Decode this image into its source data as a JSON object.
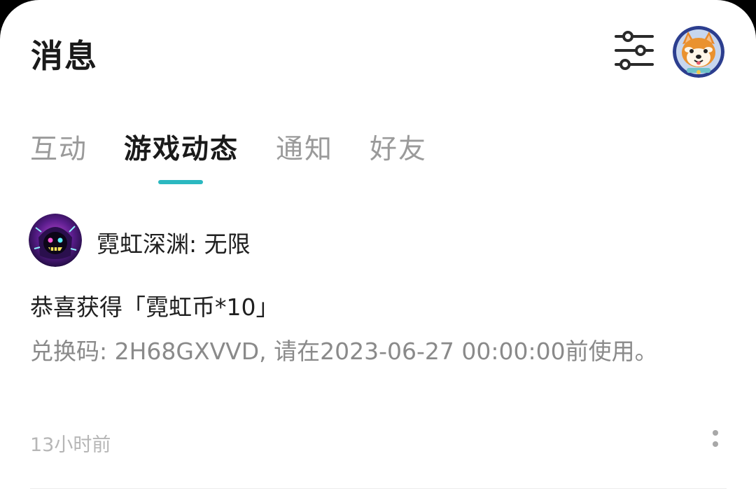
{
  "header": {
    "title": "消息",
    "filter_icon": "sliders-icon",
    "avatar_icon": "shiba-dog-avatar"
  },
  "tabs": [
    {
      "label": "互动",
      "active": false
    },
    {
      "label": "游戏动态",
      "active": true
    },
    {
      "label": "通知",
      "active": false
    },
    {
      "label": "好友",
      "active": false
    }
  ],
  "message": {
    "game_name": "霓虹深渊: 无限",
    "game_icon": "neon-abyss-game-icon",
    "title": "恭喜获得「霓虹币*10」",
    "body": "兑换码: 2H68GXVVD, 请在2023-06-27 00:00:00前使用。",
    "time": "13小时前",
    "more_icon": "more-vertical-icon"
  },
  "colors": {
    "accent": "#2bb8c0",
    "text_primary": "#1a1a1a",
    "text_secondary": "#8a8a8a",
    "text_muted": "#b6b6b6"
  }
}
